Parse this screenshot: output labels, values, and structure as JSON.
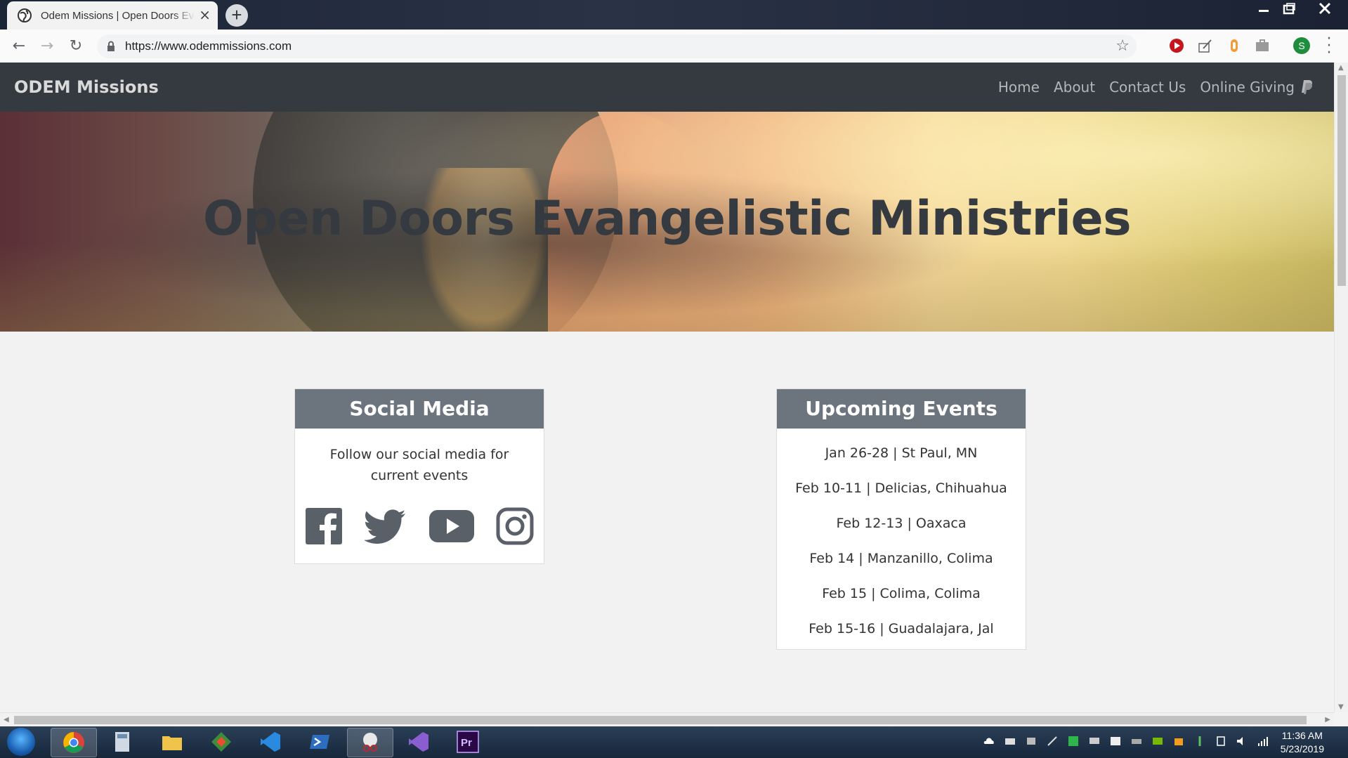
{
  "browser": {
    "tab_title": "Odem Missions | Open Doors Evangelistic Ministries",
    "url": "https://www.odemmissions.com",
    "profile_initial": "S"
  },
  "site": {
    "brand": "ODEM Missions",
    "nav": [
      "Home",
      "About",
      "Contact Us",
      "Online Giving"
    ],
    "hero_title": "Open Doors Evangelistic Ministries"
  },
  "social": {
    "title": "Social Media",
    "text": "Follow our social media for current events",
    "icons": [
      "facebook-icon",
      "twitter-icon",
      "youtube-icon",
      "instagram-icon"
    ]
  },
  "events": {
    "title": "Upcoming Events",
    "items": [
      "Jan 26-28 | St Paul, MN",
      "Feb 10-11 | Delicias, Chihuahua",
      "Feb 12-13 | Oaxaca",
      "Feb 14 | Manzanillo, Colima",
      "Feb 15 | Colima, Colima",
      "Feb 15-16 | Guadalajara, Jal"
    ]
  },
  "taskbar": {
    "time": "11:36 AM",
    "date": "5/23/2019"
  },
  "colors": {
    "navbar": "#343a40",
    "card_header": "#6c757d",
    "hero_title": "#353a41"
  }
}
